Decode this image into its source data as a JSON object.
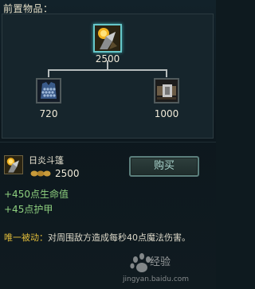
{
  "header": {
    "label": "前置物品："
  },
  "tree": {
    "root": {
      "icon": "sun-cloak-icon",
      "cost": "2500"
    },
    "children": [
      {
        "icon": "chain-vest-icon",
        "cost": "720"
      },
      {
        "icon": "giants-belt-icon",
        "cost": "1000"
      }
    ]
  },
  "detail": {
    "icon": "sun-cloak-icon",
    "name": "日炎斗篷",
    "price": "2500",
    "coin_icon": "gold-coin-icon",
    "buy_label": "购买",
    "stats": [
      "+450点生命值",
      "+45点护甲"
    ],
    "passive_label": "唯一被动：",
    "passive_text": "对周围敌方造成每秒40点魔法伤害。"
  },
  "watermark": {
    "brand": "经验",
    "url": "jingyan.baidu.com"
  },
  "colors": {
    "stat_green": "#8ed07f",
    "passive_gold": "#e2bd3a",
    "selected_border": "#66c7c9"
  }
}
